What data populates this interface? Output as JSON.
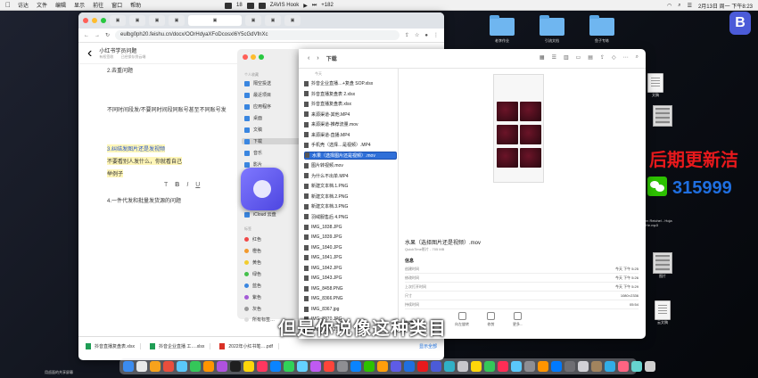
{
  "menubar": {
    "apple": "",
    "items": [
      "访达",
      "文件",
      "编辑",
      "显示",
      "前往",
      "窗口",
      "帮助"
    ],
    "center": [
      "18",
      "ZAVIS Hook",
      "+182"
    ],
    "datetime": "2月13日 周一 下午8:23"
  },
  "desktop": {
    "icons_right": [
      "老李作业",
      "引流文档",
      "鱼子专练"
    ],
    "badge_letter": "B",
    "files_right": [
      "文稿",
      "m Reichel - Hoja He.mp3",
      "图片",
      "片",
      "云文稿"
    ]
  },
  "browser": {
    "url": "eulbg0ph20.feishu.cn/docx/OOrHdyaXFoDcosxI6Y5cGdVfnXc",
    "doc_title": "小红书学员问题",
    "doc_sub": "有权签收　　已经保存到云端",
    "lines": [
      "2.去重问题",
      "不同时间段发/不要同时间段同账号甚至不同账号发",
      "3.纠结发图片还是发视频",
      "不要看别人发什么，你就看自己",
      "举例子",
      "4.一件代发和批量发货源的问题"
    ],
    "format_tools": [
      "T",
      "B",
      "I",
      "U"
    ]
  },
  "sidebar": {
    "header": "个人收藏",
    "items": [
      "隔空投送",
      "最近项目",
      "应用程序",
      "桌面",
      "文稿",
      "下载",
      "音乐",
      "影片",
      "图片",
      "iCloud 云盘"
    ],
    "tags_header": "标签",
    "tags": [
      {
        "label": "红色",
        "color": "#f04848"
      },
      {
        "label": "橙色",
        "color": "#f29a2e"
      },
      {
        "label": "黄色",
        "color": "#f2cd2e"
      },
      {
        "label": "绿色",
        "color": "#45c04b"
      },
      {
        "label": "蓝色",
        "color": "#3a86e0"
      },
      {
        "label": "紫色",
        "color": "#a35bd6"
      },
      {
        "label": "灰色",
        "color": "#9a9a9a"
      },
      {
        "label": "所有标签…",
        "color": "#dddddd"
      }
    ]
  },
  "finder": {
    "title": "下载",
    "group": "今天",
    "files": [
      "抖音企业直播…+复盘 SOP.xlsx",
      "抖音直播复盘表 2.xlsx",
      "抖音直播复盘表.xlsx",
      "来源渠道-其他.MP4",
      "来源渠道-推荐流量.mov",
      "来源渠道-直播.MP4",
      "手机壳（选择…是视频）.MP4",
      "水果（选择图片还是视频）.mov",
      "图片转视频.mov",
      "为什么不出单.MP4",
      "新建文本档.1.PNG",
      "新建文本档.2.PNG",
      "新建文本档.3.PNG",
      "羽绒服售后 4.PNG",
      "IMG_1838.JPG",
      "IMG_1839.JPG",
      "IMG_1840.JPG",
      "IMG_1841.JPG",
      "IMG_1842.JPG",
      "IMG_1843.JPG",
      "IMG_8458.PNG",
      "IMG_8366.PNG",
      "IMG_8367.jpg",
      "IMG_8370.JPG",
      "IMG_8371 2.JPG"
    ],
    "selected_index": 7,
    "preview": {
      "name": "水果（选择图片还是视频）.mov",
      "meta": "QuickTime影片 - 705 MB",
      "info_title": "信息",
      "rows": [
        {
          "k": "创建时间",
          "v": "今天 下午 5:25"
        },
        {
          "k": "修改时间",
          "v": "今天 下午 5:26"
        },
        {
          "k": "上次打开时间",
          "v": "今天 下午 5:29"
        },
        {
          "k": "尺寸",
          "v": "1080×2336"
        },
        {
          "k": "持续时间",
          "v": "05:54"
        }
      ],
      "tags_title": "标签",
      "actions": [
        "向左旋转",
        "修剪",
        "更多..."
      ]
    }
  },
  "downloads": {
    "items": [
      "抖音直播复盘表.xlsx",
      "抖音企业直播 工….xlsx",
      "2022年小红书笔….pdf"
    ],
    "show_all": "显示全部"
  },
  "subtitle": "但是你说像这种类目",
  "promo": {
    "red": "后期更新洁",
    "number": "315999"
  },
  "bottom_label": "用卤面的共享屏幕",
  "colors": {
    "accent": "#2f6fd8",
    "promo_red": "#e8191c",
    "promo_blue": "#1f6fe0"
  }
}
